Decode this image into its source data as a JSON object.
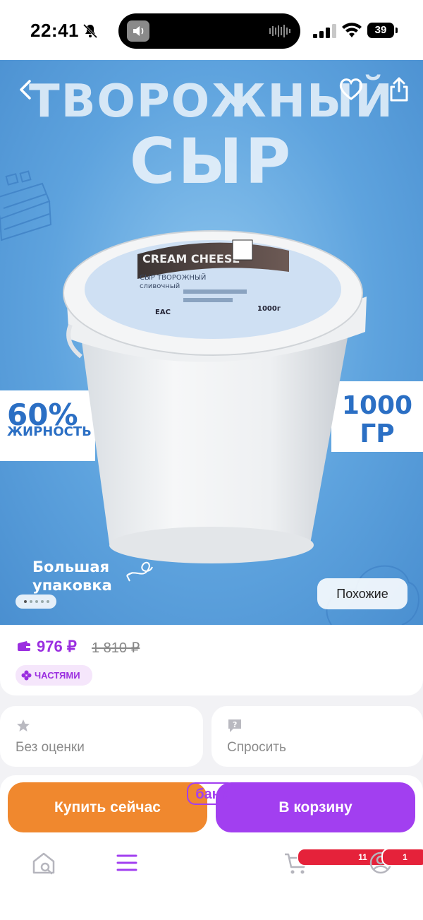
{
  "status_bar": {
    "time": "22:41",
    "battery": "39"
  },
  "hero": {
    "title_line1": "ТВОРОЖНЫЙ",
    "title_line2": "СЫР",
    "fat_percent": "60%",
    "fat_label": "ЖИРНОСТЬ",
    "weight_line1": "1000",
    "weight_line2": "ГР",
    "package_line1": "Большая",
    "package_line2": "упаковка",
    "similar_label": "Похожие",
    "gallery_dots": 5,
    "gallery_active": 1,
    "label_brand": "CREAM CHEESE",
    "label_sub": "СЫР ТВОРОЖНЫЙ",
    "label_sub2": "сливочный",
    "label_weight": "1000г",
    "label_eac": "EAC"
  },
  "price": {
    "current": "976 ₽",
    "old": "1 810 ₽",
    "parts_label": "ЧАСТЯМИ"
  },
  "cards": {
    "rating_label": "Без оценки",
    "ask_label": "Спросить"
  },
  "actions": {
    "buy_now": "Купить сейчас",
    "add_to_cart": "В корзину"
  },
  "nav": {
    "bank_label": "банк",
    "cart_badge": "11",
    "profile_badge": "1"
  },
  "colors": {
    "accent": "#a23ff0",
    "buy": "#f0882e",
    "badge": "#e5223a",
    "hero_blue": "#5ea3de"
  }
}
